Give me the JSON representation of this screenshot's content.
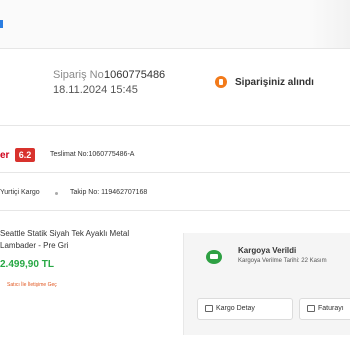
{
  "order": {
    "label": "Sipariş No",
    "number": "1060775486",
    "date": "18.11.2024 15:45",
    "status": "Siparişiniz alındı"
  },
  "seller": {
    "name_fragment": "er",
    "score": "6.2",
    "delivery_no": "Teslimat No:1060775486-A"
  },
  "shipment": {
    "company": "Yurtiçi Kargo",
    "tracking": "Takip No: 119462707168"
  },
  "product": {
    "name": "Seattle Statik Siyah Tek Ayaklı Metal Lambader - Pre Gri",
    "price": "2.499,90 TL",
    "contact_seller": "Satıcı İle İletişime Geç"
  },
  "cargo": {
    "status": "Kargoya Verildi",
    "date": "Kargoya Verilme Tarihi: 22 Kasım",
    "detail_button": "Kargo Detay",
    "invoice_button": "Faturayı"
  },
  "colors": {
    "accent_orange": "#f27a1a",
    "score_red": "#d8322d",
    "price_green": "#27a844"
  }
}
